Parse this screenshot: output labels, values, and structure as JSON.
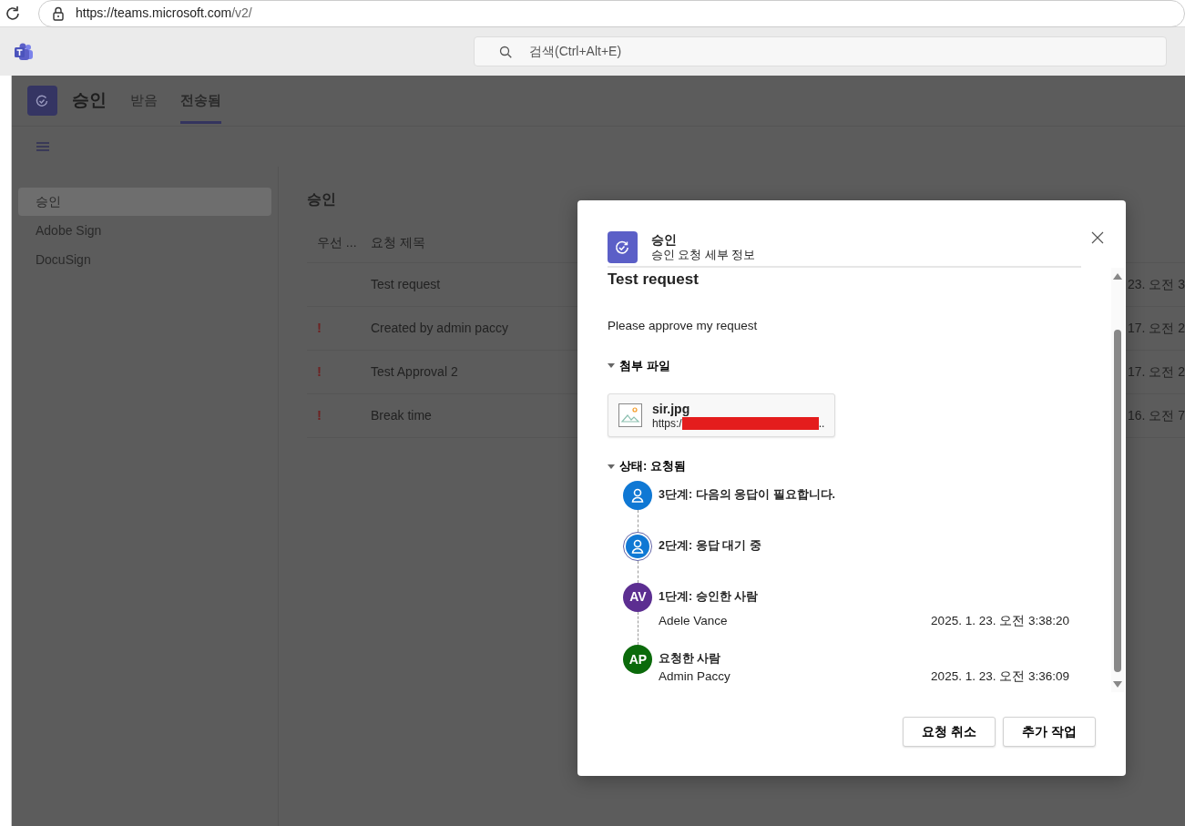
{
  "browser": {
    "url_host": "https://teams.microsoft.com",
    "url_path": "/v2/"
  },
  "teams_header": {
    "search": {
      "placeholder": "검색(Ctrl+Alt+E)"
    }
  },
  "app_header": {
    "title": "승인",
    "tabs": [
      {
        "label": "받음",
        "selected": false
      },
      {
        "label": "전송됨",
        "selected": true
      }
    ]
  },
  "sidebar": {
    "items": [
      {
        "label": "승인",
        "selected": true
      },
      {
        "label": "Adobe Sign",
        "selected": false
      },
      {
        "label": "DocuSign",
        "selected": false
      }
    ]
  },
  "main": {
    "title": "승인",
    "table": {
      "columns": [
        "우선 ...",
        "요청 제목"
      ],
      "rows": [
        {
          "title": "Test request",
          "column_3": "23. 오전 3"
        },
        {
          "priority": "!",
          "title": "Created by admin paccy",
          "column_3": "17. 오전 2"
        },
        {
          "priority": "!",
          "title": "Test Approval 2",
          "column_3": "17. 오전 2"
        },
        {
          "priority": "!",
          "title": "Break time",
          "column_3": "16. 오전 7"
        }
      ]
    }
  },
  "dialog": {
    "app_name": "승인",
    "subtitle": "승인 요청 세부 정보",
    "title": "Test request",
    "description": "Please approve my request",
    "attachments": {
      "label": "첨부 파일",
      "expanded": true,
      "files": [
        {
          "name": "sir.jpg",
          "url": "https:/",
          "redacted": true,
          "ellipsis": ".."
        }
      ]
    },
    "status": {
      "label": "상태: 요청됨",
      "expanded": true,
      "steps": [
        {
          "kind": "person",
          "color": "#0f78d4",
          "current": false,
          "title": "3단계: 다음의 응답이 필요합니다."
        },
        {
          "kind": "person",
          "color": "#0f78d4",
          "current": true,
          "title": "2단계: 응답 대기 중"
        },
        {
          "kind": "initials",
          "initials": "AV",
          "color": "#5c2e91",
          "current": false,
          "title": "1단계: 승인한 사람",
          "name": "Adele Vance",
          "time": "2025. 1. 23. 오전 3:38:20"
        },
        {
          "kind": "initials",
          "initials": "AP",
          "color": "#0b6a0b",
          "current": false,
          "title": "요청한 사람",
          "name": "Admin Paccy",
          "time": "2025. 1. 23. 오전 3:36:09"
        }
      ]
    },
    "buttons": [
      "요청 취소",
      "추가 작업"
    ]
  }
}
